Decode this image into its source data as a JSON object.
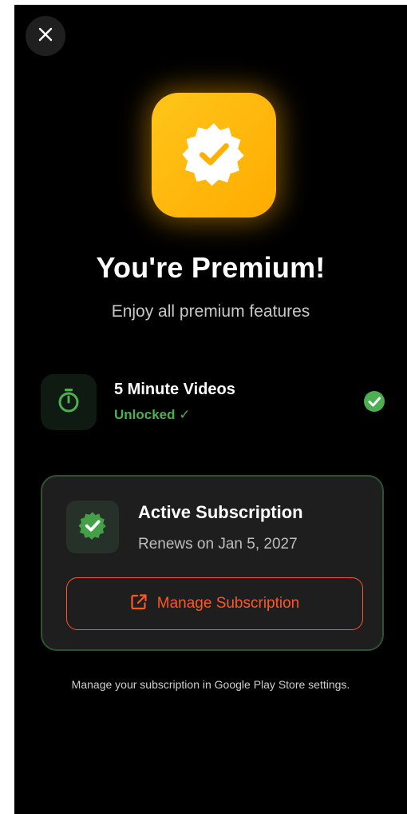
{
  "header": {
    "close_icon": "close-icon"
  },
  "hero": {
    "badge_icon": "verified-badge-icon",
    "badge_color": "#FFB300",
    "title": "You're Premium!",
    "subtitle": "Enjoy all premium features"
  },
  "feature": {
    "icon": "timer-icon",
    "name": "5 Minute Videos",
    "status": "Unlocked ✓",
    "check_icon": "check-circle-icon",
    "accent_color": "#4CAF50"
  },
  "subscription": {
    "icon": "verified-badge-icon",
    "title": "Active Subscription",
    "renewal": "Renews on Jan 5, 2027",
    "manage_icon": "external-link-icon",
    "manage_label": "Manage Subscription",
    "manage_color": "#FF5722"
  },
  "footer": {
    "note": "Manage your subscription in Google Play Store settings."
  }
}
